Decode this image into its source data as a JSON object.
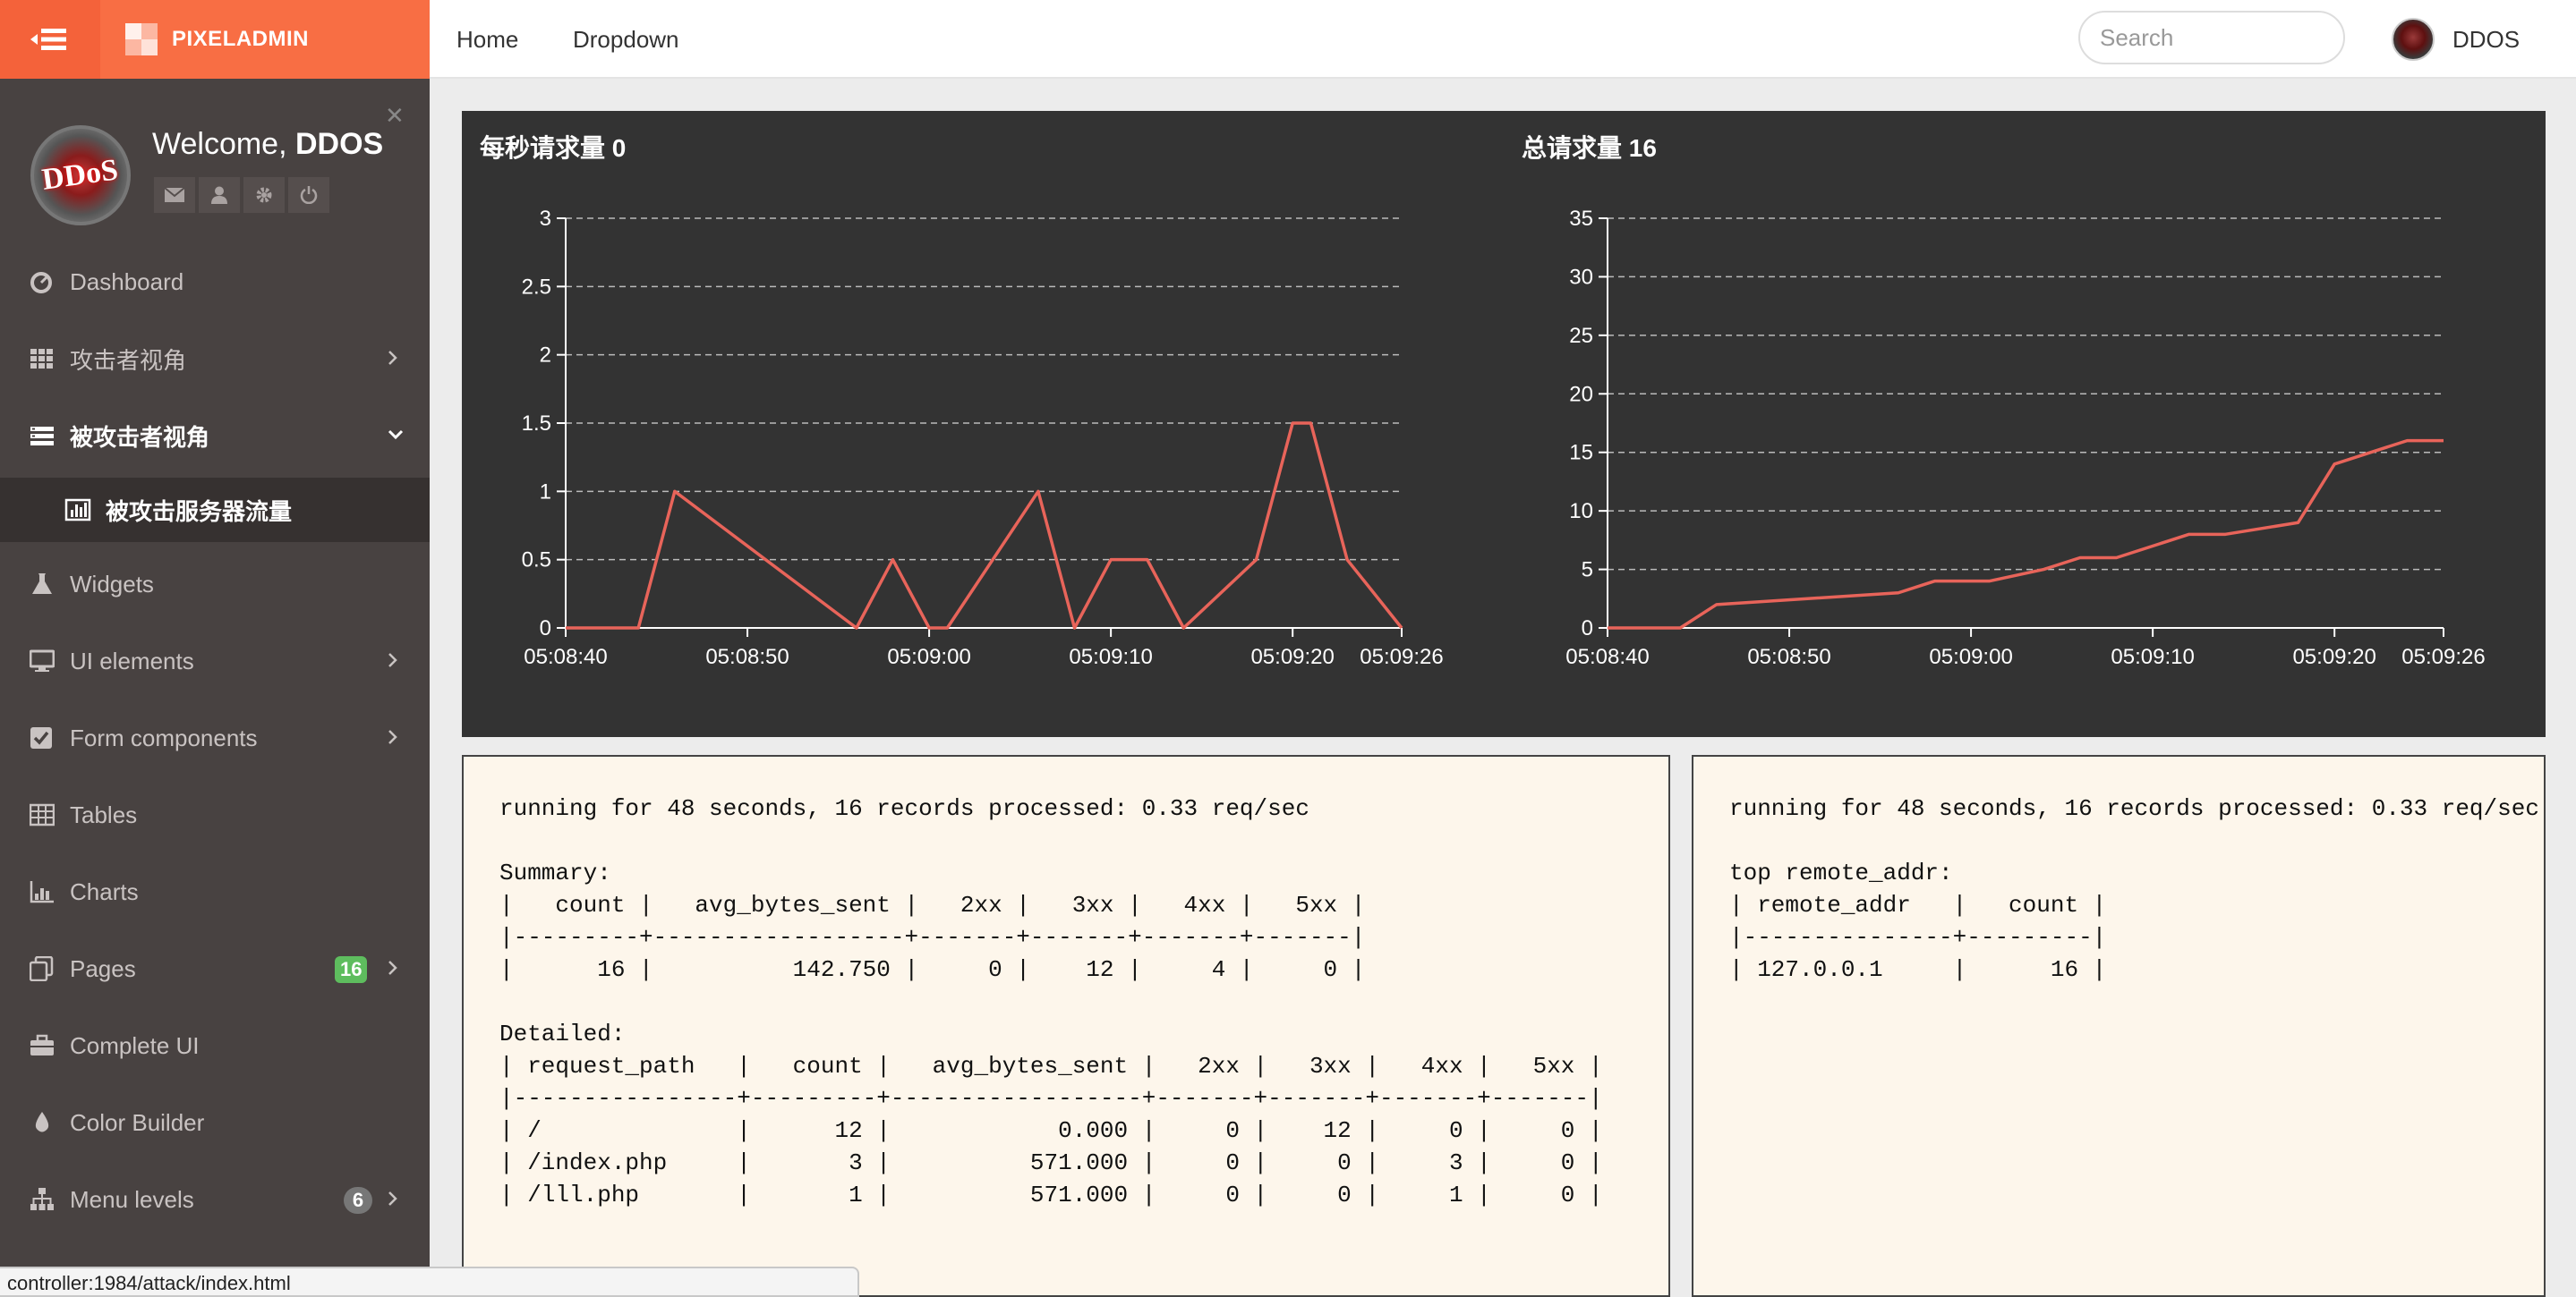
{
  "header": {
    "brand": "PIXELADMIN",
    "nav": [
      "Home",
      "Dropdown"
    ],
    "search_placeholder": "Search",
    "user_name": "DDOS"
  },
  "sidebar": {
    "welcome_prefix": "Welcome, ",
    "welcome_user": "DDOS",
    "avatar_text": "DDoS",
    "items": [
      {
        "label": "Dashboard",
        "icon": "dashboard-icon"
      },
      {
        "label": "攻击者视角",
        "icon": "grid-icon",
        "chevron": "right"
      },
      {
        "label": "被攻击者视角",
        "icon": "list-icon",
        "chevron": "down",
        "active": true
      },
      {
        "label": "被攻击服务器流量",
        "icon": "bar-chart-icon",
        "sub": true
      },
      {
        "label": "Widgets",
        "icon": "flask-icon"
      },
      {
        "label": "UI elements",
        "icon": "desktop-icon",
        "chevron": "right"
      },
      {
        "label": "Form components",
        "icon": "check-square-icon",
        "chevron": "right"
      },
      {
        "label": "Tables",
        "icon": "table-icon"
      },
      {
        "label": "Charts",
        "icon": "chart-icon"
      },
      {
        "label": "Pages",
        "icon": "copy-icon",
        "badge": "16",
        "badge_color": "#5ebd5e",
        "chevron": "right"
      },
      {
        "label": "Complete UI",
        "icon": "briefcase-icon"
      },
      {
        "label": "Color Builder",
        "icon": "tint-icon"
      },
      {
        "label": "Menu levels",
        "icon": "sitemap-icon",
        "badge": "6",
        "badge_color": "#777",
        "chevron": "right"
      }
    ]
  },
  "chart_data": [
    {
      "type": "line",
      "title": "每秒请求量 0",
      "x": [
        "05:08:40",
        "05:08:42",
        "05:08:43",
        "05:08:52",
        "05:08:55",
        "05:08:56",
        "05:08:57",
        "05:08:58",
        "05:09:01",
        "05:09:02",
        "05:09:03",
        "05:09:04",
        "05:09:06",
        "05:09:08",
        "05:09:19",
        "05:09:20",
        "05:09:21",
        "05:09:22",
        "05:09:23",
        "05:09:24",
        "05:09:26"
      ],
      "values": [
        0,
        0,
        0,
        1,
        0,
        0.5,
        0,
        0,
        1,
        0,
        0.5,
        0.5,
        0,
        0.5,
        1.5,
        1.5,
        0.5,
        0
      ],
      "points": [
        [
          "05:08:40",
          0
        ],
        [
          "05:08:44",
          0
        ],
        [
          "05:08:46",
          1
        ],
        [
          "05:08:56",
          0
        ],
        [
          "05:08:58",
          0.5
        ],
        [
          "05:09:00",
          0
        ],
        [
          "05:09:01",
          0
        ],
        [
          "05:09:06",
          1
        ],
        [
          "05:09:08",
          0
        ],
        [
          "05:09:10",
          0.5
        ],
        [
          "05:09:12",
          0.5
        ],
        [
          "05:09:14",
          0
        ],
        [
          "05:09:18",
          0.5
        ],
        [
          "05:09:20",
          1.5
        ],
        [
          "05:09:21",
          1.5
        ],
        [
          "05:09:23",
          0.5
        ],
        [
          "05:09:26",
          0
        ]
      ],
      "x_ticks": [
        "05:08:40",
        "05:08:50",
        "05:09:00",
        "05:09:10",
        "05:09:20",
        "05:09:26"
      ],
      "y_ticks": [
        "0",
        "0.5",
        "1",
        "1.5",
        "2",
        "2.5",
        "3"
      ],
      "ylim": [
        0,
        3
      ],
      "color": "#e8645a",
      "grid": true
    },
    {
      "type": "line",
      "title": "总请求量 16",
      "points": [
        [
          "05:08:40",
          0
        ],
        [
          "05:08:44",
          0
        ],
        [
          "05:08:46",
          2
        ],
        [
          "05:08:56",
          3
        ],
        [
          "05:08:58",
          4
        ],
        [
          "05:09:00",
          4
        ],
        [
          "05:09:01",
          4
        ],
        [
          "05:09:04",
          5
        ],
        [
          "05:09:06",
          6
        ],
        [
          "05:09:08",
          6
        ],
        [
          "05:09:12",
          8
        ],
        [
          "05:09:14",
          8
        ],
        [
          "05:09:18",
          9
        ],
        [
          "05:09:20",
          14
        ],
        [
          "05:09:22",
          15
        ],
        [
          "05:09:24",
          16
        ],
        [
          "05:09:26",
          16
        ]
      ],
      "x_ticks": [
        "05:08:40",
        "05:08:50",
        "05:09:00",
        "05:09:10",
        "05:09:20",
        "05:09:26"
      ],
      "y_ticks": [
        "0",
        "5",
        "10",
        "15",
        "20",
        "25",
        "30",
        "35"
      ],
      "ylim": [
        0,
        35
      ],
      "color": "#e8645a",
      "grid": true
    }
  ],
  "terminal_left": {
    "lines": [
      "running for 48 seconds, 16 records processed: 0.33 req/sec",
      "",
      "Summary:",
      "|   count |   avg_bytes_sent |   2xx |   3xx |   4xx |   5xx |",
      "|---------+------------------+-------+-------+-------+-------|",
      "|      16 |          142.750 |     0 |    12 |     4 |     0 |",
      "",
      "Detailed:",
      "| request_path   |   count |   avg_bytes_sent |   2xx |   3xx |   4xx |   5xx |",
      "|----------------+---------+------------------+-------+-------+-------+-------|",
      "| /              |      12 |            0.000 |     0 |    12 |     0 |     0 |",
      "| /index.php     |       3 |          571.000 |     0 |     0 |     3 |     0 |",
      "| /lll.php       |       1 |          571.000 |     0 |     0 |     1 |     0 |"
    ]
  },
  "terminal_right": {
    "lines": [
      "running for 48 seconds, 16 records processed: 0.33 req/sec",
      "",
      "top remote_addr:",
      "| remote_addr   |   count |",
      "|---------------+---------|",
      "| 127.0.0.1     |      16 |"
    ]
  },
  "status_bar": {
    "url": "controller:1984/attack/index.html"
  },
  "colors": {
    "brand": "#f86e44",
    "brand_dark": "#f4623a",
    "sidebar": "#484241",
    "chart_bg": "#333333",
    "line": "#e8645a"
  }
}
